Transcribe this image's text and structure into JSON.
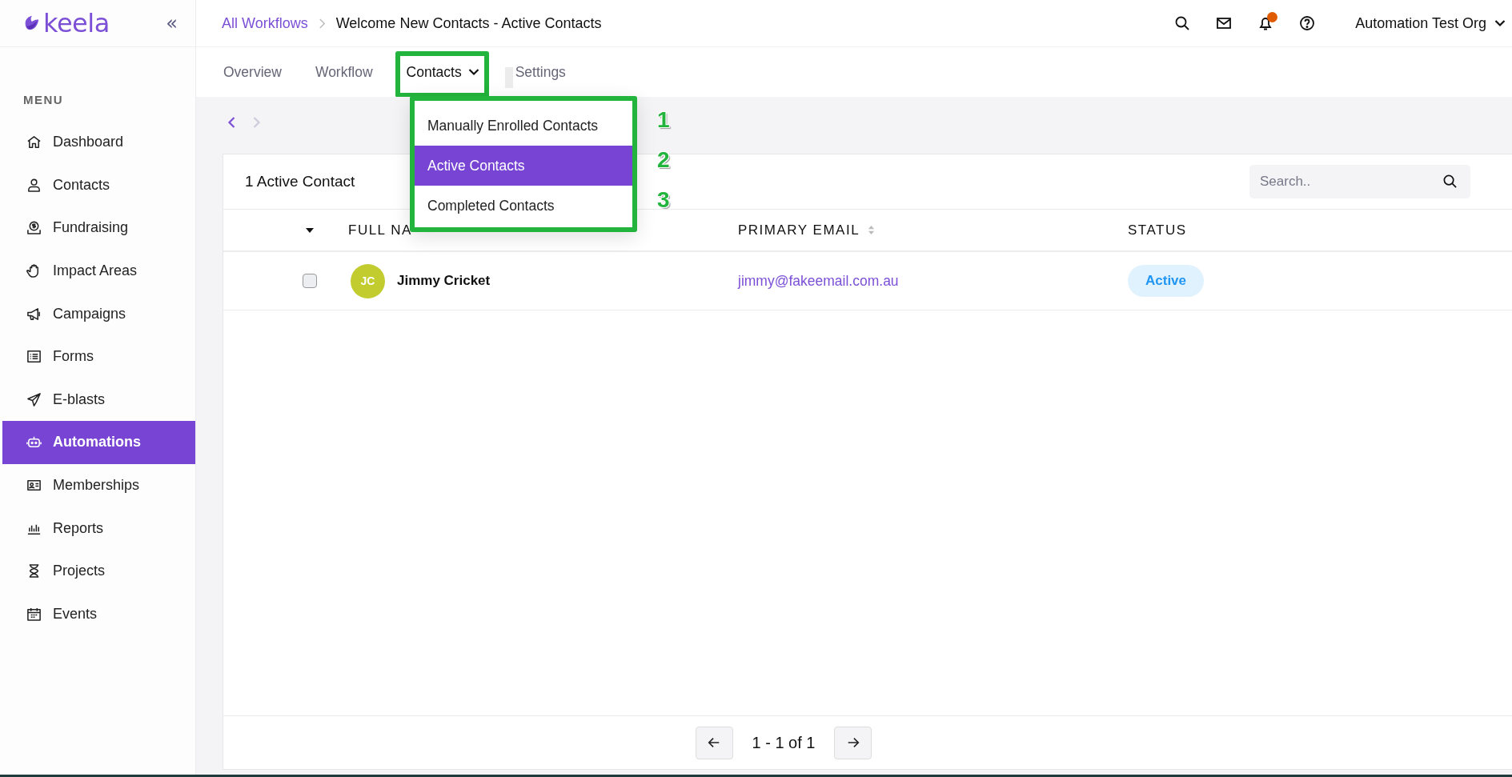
{
  "sidebar": {
    "logo": "keela",
    "collapse": "«",
    "menu_label": "MENU",
    "items": [
      {
        "label": "Dashboard",
        "selected": false
      },
      {
        "label": "Contacts",
        "selected": false
      },
      {
        "label": "Fundraising",
        "selected": false
      },
      {
        "label": "Impact Areas",
        "selected": false
      },
      {
        "label": "Campaigns",
        "selected": false
      },
      {
        "label": "Forms",
        "selected": false
      },
      {
        "label": "E-blasts",
        "selected": false
      },
      {
        "label": "Automations",
        "selected": true
      },
      {
        "label": "Memberships",
        "selected": false
      },
      {
        "label": "Reports",
        "selected": false
      },
      {
        "label": "Projects",
        "selected": false
      },
      {
        "label": "Events",
        "selected": false
      }
    ]
  },
  "breadcrumb": {
    "parent": "All Workflows",
    "current": "Welcome New Contacts - Active Contacts"
  },
  "header": {
    "unread_notifications": true,
    "org": "Automation Test Org"
  },
  "tabs": [
    {
      "label": "Overview",
      "selected": false,
      "has_menu": false
    },
    {
      "label": "Workflow",
      "selected": false,
      "has_menu": false
    },
    {
      "label": "Contacts",
      "selected": true,
      "has_menu": true
    },
    {
      "label": "Settings",
      "selected": false,
      "has_menu": false
    }
  ],
  "dropdown": {
    "items": [
      {
        "label": "Manually Enrolled Contacts",
        "selected": false
      },
      {
        "label": "Active Contacts",
        "selected": true
      },
      {
        "label": "Completed Contacts",
        "selected": false
      }
    ]
  },
  "annotations": [
    "1",
    "2",
    "3"
  ],
  "nav": {
    "back_enabled": true,
    "forward_enabled": false
  },
  "card": {
    "title": "1 Active Contact",
    "search": {
      "placeholder": "Search.."
    },
    "columns": [
      {
        "label": "FULL NA",
        "sortable": false
      },
      {
        "label": "PRIMARY EMAIL",
        "sortable": true
      },
      {
        "label": "STATUS",
        "sortable": false
      }
    ],
    "rows": [
      {
        "checked": false,
        "initials": "JC",
        "color": "#c2cc2f",
        "name": "Jimmy Cricket",
        "email": "jimmy@fakeemail.com.au",
        "status": "Active"
      }
    ]
  },
  "pagination": {
    "range": "1 - 1 of 1"
  }
}
